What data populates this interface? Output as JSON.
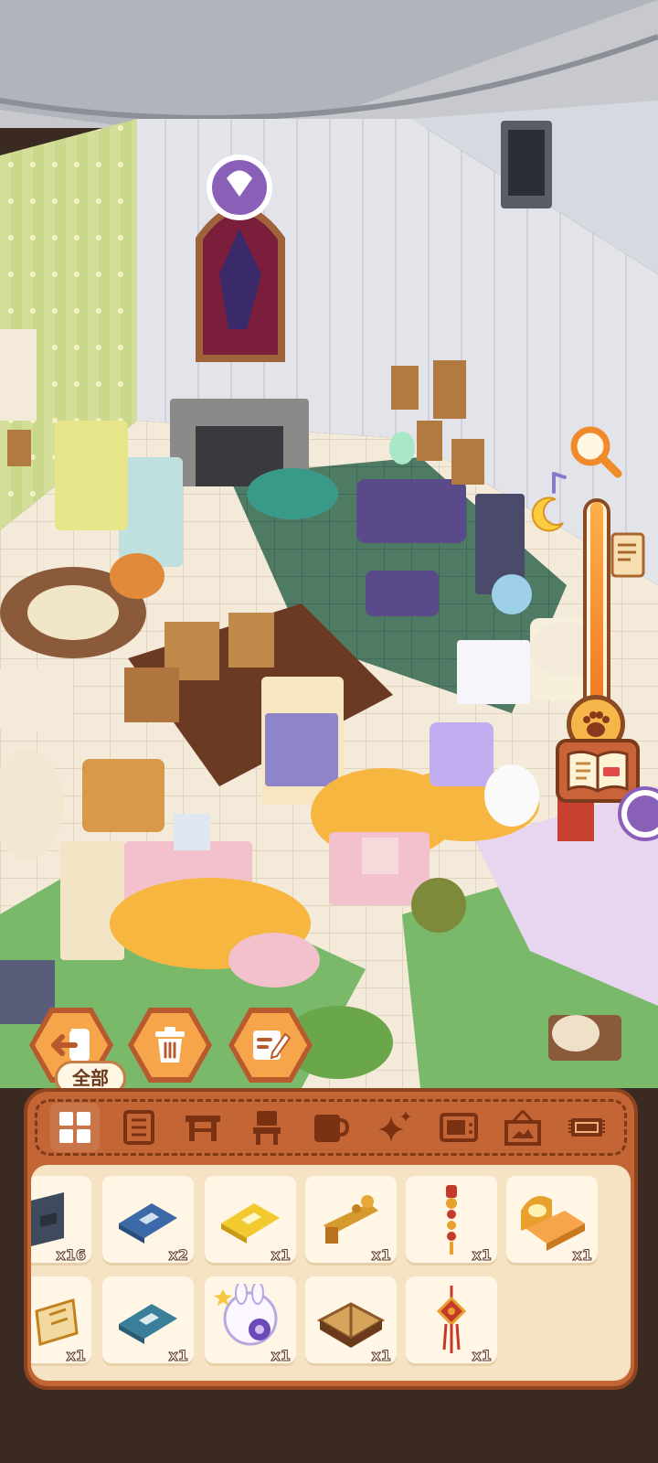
{
  "tooltip": {
    "label": "全部"
  },
  "actions": [
    {
      "name": "exit-button",
      "icon": "exit-icon"
    },
    {
      "name": "delete-button",
      "icon": "trash-icon"
    },
    {
      "name": "edit-button",
      "icon": "edit-icon"
    }
  ],
  "tabs": [
    {
      "name": "tab-all",
      "icon": "grid-icon",
      "active": true
    },
    {
      "name": "tab-cabinets",
      "icon": "cabinet-icon"
    },
    {
      "name": "tab-tables",
      "icon": "table-icon"
    },
    {
      "name": "tab-chairs",
      "icon": "chair-icon"
    },
    {
      "name": "tab-cups",
      "icon": "cup-icon"
    },
    {
      "name": "tab-sparkles",
      "icon": "sparkle-icon"
    },
    {
      "name": "tab-electronics",
      "icon": "tv-icon"
    },
    {
      "name": "tab-frames",
      "icon": "frame-icon"
    },
    {
      "name": "tab-rugs",
      "icon": "rug-icon"
    }
  ],
  "inventory": [
    {
      "item": "dark-cabinet",
      "count": "x16"
    },
    {
      "item": "blue-book",
      "count": "x2"
    },
    {
      "item": "yellow-book",
      "count": "x1"
    },
    {
      "item": "golden-scroll-rack",
      "count": "x1"
    },
    {
      "item": "chinese-lantern-hanging",
      "count": "x1"
    },
    {
      "item": "orange-bed",
      "count": "x1"
    },
    {
      "item": "open-recipe-book",
      "count": "x1"
    },
    {
      "item": "teal-book",
      "count": "x1"
    },
    {
      "item": "bunny-moon-lamp",
      "count": "x1"
    },
    {
      "item": "open-spell-book",
      "count": "x1"
    },
    {
      "item": "red-knot-charm",
      "count": "x1"
    }
  ],
  "colors": {
    "panel": "#c46535",
    "panel_border": "#8d4220",
    "grid_bg": "#f6e3c3",
    "slot": "#fff6e6",
    "accent": "#f6a54a"
  }
}
